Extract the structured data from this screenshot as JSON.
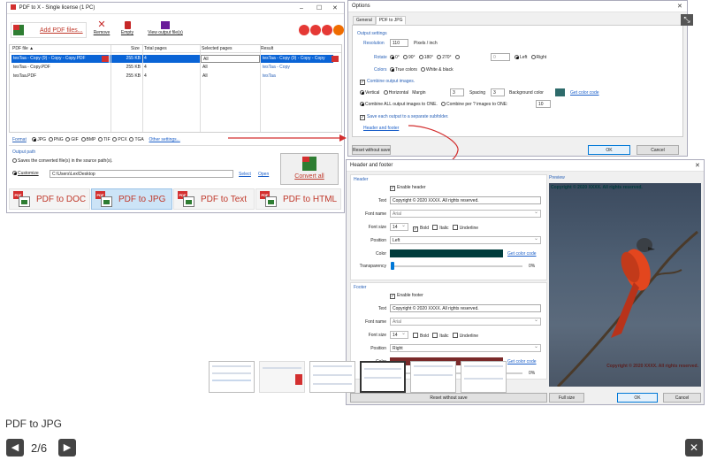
{
  "main_window": {
    "title": "PDF to X - Single license (1 PC)",
    "toolbar": {
      "add": "Add PDF files...",
      "remove": "Remove",
      "empty": "Empty",
      "view": "View output file(s)"
    },
    "columns": [
      "PDF file ▲",
      "Size",
      "Total pages",
      "Selected pages",
      "Result"
    ],
    "rows": [
      {
        "file": "tesTaa - Copy (9) - Copy - Copy.PDF",
        "size": "255 KB",
        "pages": "4",
        "selected": "All",
        "result": "tesTaa - Copy (9) - Copy - Copy"
      },
      {
        "file": "tesTaa - Copy.PDF",
        "size": "255 KB",
        "pages": "4",
        "selected": "All",
        "result": "tesTaa - Copy"
      },
      {
        "file": "tesTaa.PDF",
        "size": "255 KB",
        "pages": "4",
        "selected": "All",
        "result": "tesTaa"
      }
    ],
    "format_label": "Format",
    "formats": [
      "JPG",
      "PNG",
      "GIF",
      "BMP",
      "TIF",
      "PCX",
      "TGA"
    ],
    "other_settings": "Other settings...",
    "output_path_label": "Output path",
    "source_option": "Saves the converted file(s) in the source path(s).",
    "customize_label": "Customize",
    "customize_path": "C:\\Users\\Lex\\Desktop",
    "select": "Select",
    "open": "Open",
    "convert_all": "Convert all",
    "tiles": [
      "PDF to DOC",
      "PDF to JPG",
      "PDF to Text",
      "PDF to HTML"
    ]
  },
  "options": {
    "title": "Options",
    "tabs": [
      "General",
      "PDF to JPG"
    ],
    "section": "Output settings",
    "resolution_label": "Resolution",
    "resolution_value": "110",
    "resolution_unit": "Pixels / inch",
    "rotate_label": "Rotate",
    "rotate_options": [
      "0°",
      "90°",
      "180°",
      "270°"
    ],
    "rotate_custom": "0",
    "align_left": "Left",
    "align_right": "Right",
    "colors_label": "Colors",
    "true_colors": "True colors",
    "white_black": "White & black",
    "combine": "Combine output images.",
    "vertical": "Vertical",
    "horizontal": "Horizontal",
    "margin_label": "Margin",
    "margin_value": "3",
    "spacing_label": "Spacing",
    "spacing_value": "3",
    "bg_label": "Background color",
    "get_color": "Get color code",
    "combine_all": "Combine ALL output images to ONE.",
    "combine_per": "Combine per ? images to ONE:",
    "combine_per_value": "10",
    "save_each": "Save each output to a separate subfolder.",
    "header_footer": "Header and footer",
    "reset": "Reset without save",
    "ok": "OK",
    "cancel": "Cancel"
  },
  "hf": {
    "title": "Header and footer",
    "header_section": "Header",
    "enable_header": "Enable header",
    "text_label": "Text",
    "header_text": "Copyright © 2020 XXXX. All rights reserved.",
    "font_name_label": "Font name",
    "font_name": "Arial",
    "font_size_label": "Font size",
    "font_size": "14",
    "bold": "Bold",
    "italic": "Italic",
    "underline": "Underline",
    "position_label": "Position",
    "header_position": "Left",
    "color_label": "Color",
    "get_color": "Get color code",
    "transparency_label": "Transparency",
    "header_transparency": "0%",
    "footer_section": "Footer",
    "enable_footer": "Enable footer",
    "footer_text": "Copyright © 2020 XXXX. All rights reserved.",
    "footer_font": "Arial",
    "footer_size": "14",
    "footer_position": "Right",
    "footer_transparency": "0%",
    "preview_label": "Preview",
    "preview_header": "Copyright © 2020 XXXX. All rights reserved.",
    "preview_footer": "Copyright © 2020 XXXX. All rights reserved.",
    "reset": "Reset without save",
    "full_size": "Full size",
    "ok": "OK",
    "cancel": "Cancel",
    "header_color": "#003c3c",
    "footer_color": "#7a2a2a"
  },
  "caption": "PDF to JPG",
  "pager": "2/6"
}
